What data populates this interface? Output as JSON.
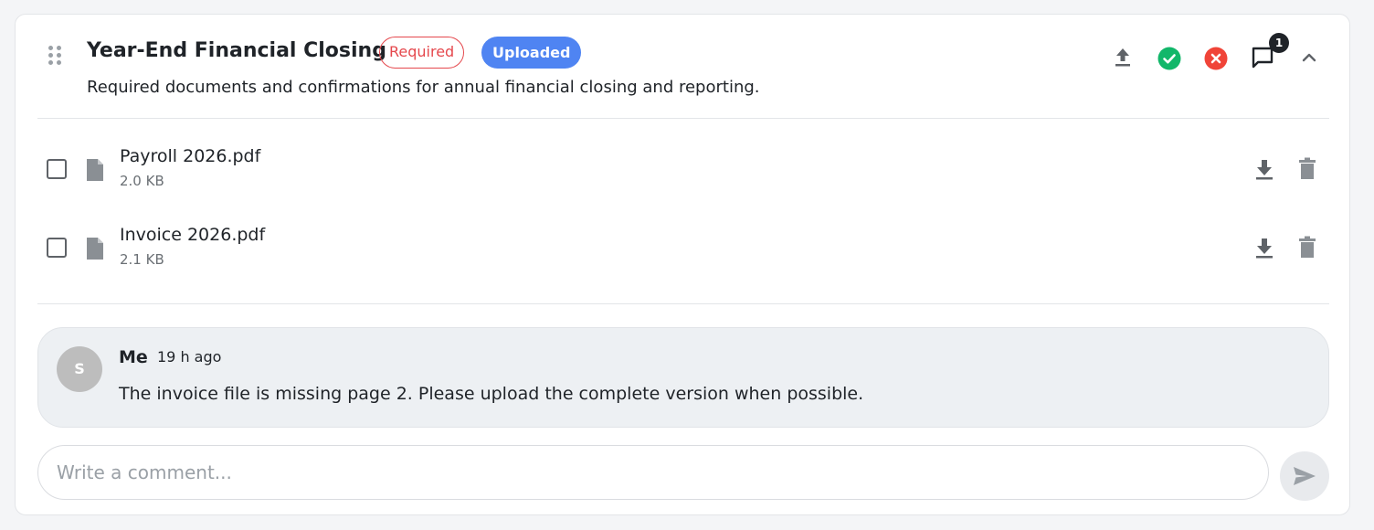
{
  "item": {
    "title": "Year-End Financial Closing",
    "badges": {
      "required": "Required",
      "uploaded": "Uploaded"
    },
    "description": "Required documents and confirmations for annual financial closing and reporting.",
    "comment_count": "1",
    "header_icons": [
      "drag-icon",
      "upload-icon",
      "approve-check-icon",
      "reject-x-icon",
      "comment-icon",
      "chevron-up-icon"
    ]
  },
  "files": [
    {
      "name": "Payroll 2026.pdf",
      "size": "2.0 KB"
    },
    {
      "name": "Invoice 2026.pdf",
      "size": "2.1 KB"
    }
  ],
  "comments": [
    {
      "avatar_initial": "S",
      "author": "Me",
      "time": "19 h ago",
      "text": "The invoice file is missing page 2. Please upload the complete version when possible."
    }
  ],
  "composer": {
    "placeholder": "Write a comment..."
  },
  "colors": {
    "required": "#e5484d",
    "uploaded": "#4f84f2",
    "approve": "#12b76a",
    "reject": "#f04438",
    "comment_bg": "#edf0f3"
  }
}
